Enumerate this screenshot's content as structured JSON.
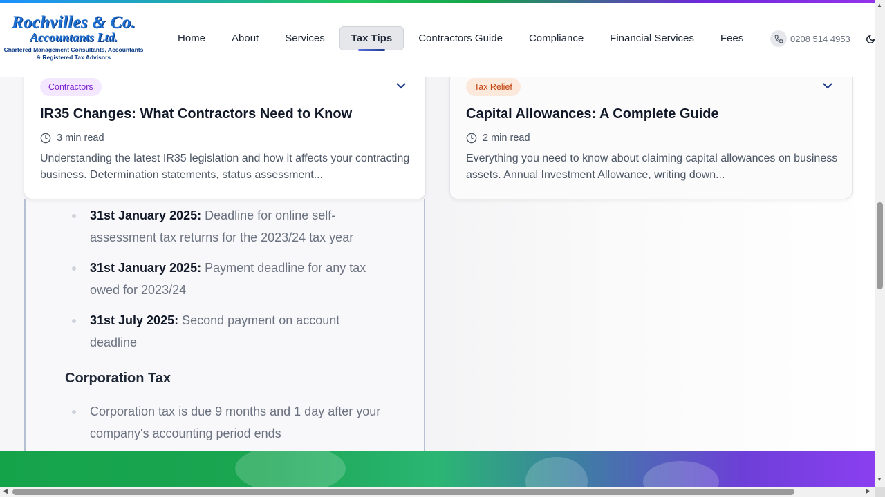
{
  "brand": {
    "line1": "Rochvilles & Co.",
    "line2": "Accountants Ltd.",
    "tagline1": "Chartered Management Consultants, Accountants",
    "tagline2": "& Registered Tax Advisors"
  },
  "nav": {
    "items": [
      {
        "label": "Home"
      },
      {
        "label": "About"
      },
      {
        "label": "Services"
      },
      {
        "label": "Tax Tips",
        "active": true
      },
      {
        "label": "Contractors Guide"
      },
      {
        "label": "Compliance"
      },
      {
        "label": "Financial Services"
      },
      {
        "label": "Fees"
      }
    ],
    "phone": "0208 514 4953"
  },
  "cards": [
    {
      "tag": "Contractors",
      "title": "IR35 Changes: What Contractors Need to Know",
      "read_time": "3 min read",
      "excerpt": "Understanding the latest IR35 legislation and how it affects your contracting business. Determination statements, status assessment..."
    },
    {
      "tag": "Tax Relief",
      "title": "Capital Allowances: A Complete Guide",
      "read_time": "2 min read",
      "excerpt": "Everything you need to know about claiming capital allowances on business assets. Annual Investment Allowance, writing down..."
    }
  ],
  "expanded": {
    "deadlines": [
      {
        "date": "31st January 2025:",
        "text": "Deadline for online self-assessment tax returns for the 2023/24 tax year"
      },
      {
        "date": "31st January 2025:",
        "text": "Payment deadline for any tax owed for 2023/24"
      },
      {
        "date": "31st July 2025:",
        "text": "Second payment on account deadline"
      }
    ],
    "corporation_heading": "Corporation Tax",
    "corporation_items": [
      {
        "text": "Corporation tax is due 9 months and 1 day after your company's accounting period ends"
      }
    ]
  },
  "colors": {
    "accent_gradient_start": "#15a34a",
    "accent_gradient_end": "#8b3ff0",
    "tag_contractors_bg": "#f3e8ff",
    "tag_contractors_fg": "#7e22ce",
    "tag_taxrelief_bg": "#fde9dc",
    "tag_taxrelief_fg": "#c2410c"
  },
  "icons": {
    "phone": "phone-icon",
    "theme": "moon-icon",
    "clock": "clock-icon",
    "expand": "chevron-down-icon"
  }
}
